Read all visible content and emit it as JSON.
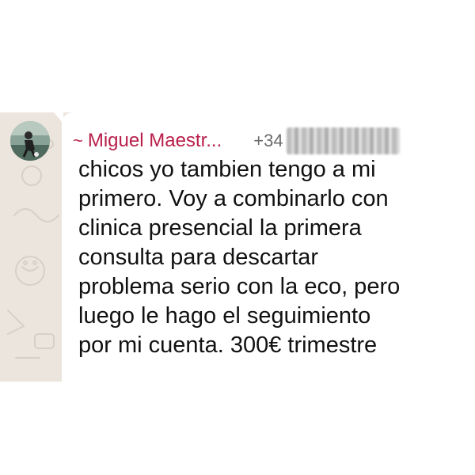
{
  "message": {
    "sender_prefix": "~",
    "sender_name": "Miguel Maestr...",
    "phone_prefix": "+34",
    "text": "chicos yo tambien tengo a mi\nprimero. Voy a combinarlo con\nclinica presencial la primera\nconsulta para descartar\nproblema serio con la eco, pero\nluego le hago el seguimiento\npor mi cuenta. 300€ trimestre"
  },
  "colors": {
    "sender": "#b81e4a",
    "chat_background": "#ece5dd",
    "bubble": "#ffffff",
    "text": "#111111"
  },
  "icons": {
    "avatar": "profile-photo-icon",
    "phone_obscured": "redacted-phone-number"
  }
}
